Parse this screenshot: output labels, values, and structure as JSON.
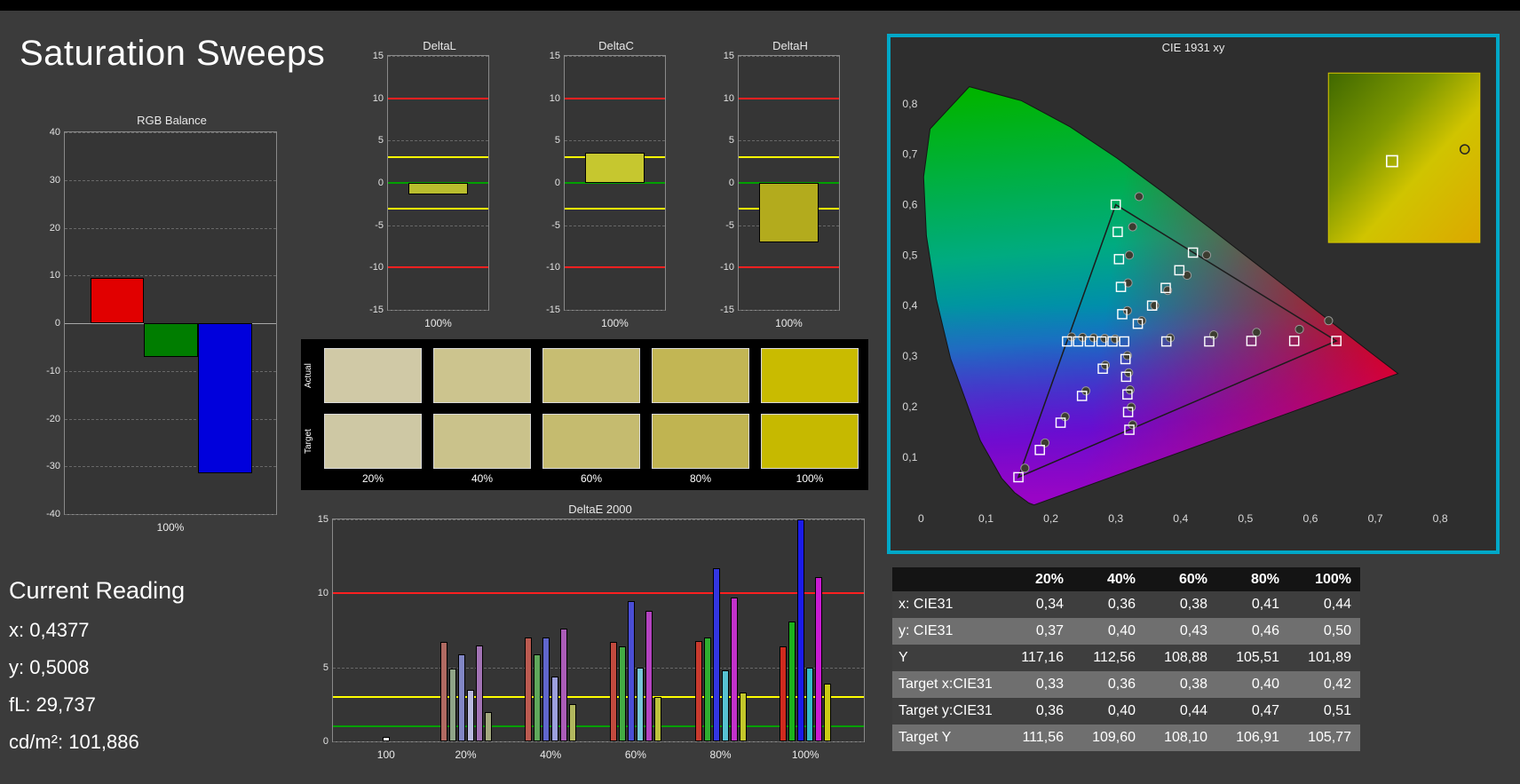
{
  "page": {
    "title": "Saturation Sweeps"
  },
  "current_reading": {
    "heading": "Current Reading",
    "x": "x: 0,4377",
    "y": "y: 0,5008",
    "fl": "fL: 29,737",
    "cdm2": "cd/m²: 101,886"
  },
  "colors": {
    "background": "#3b3b3b",
    "panel_highlight": "#00a8c8",
    "ref_red": "#ff2020",
    "ref_yellow": "#ffff00",
    "ref_green": "#00a000"
  },
  "swatches": {
    "row_labels": [
      "Actual",
      "Target"
    ],
    "col_labels": [
      "20%",
      "40%",
      "60%",
      "80%",
      "100%"
    ],
    "actual": [
      "#d0c9a6",
      "#ccc48e",
      "#c7bd72",
      "#c2b654",
      "#c9bb00"
    ],
    "target": [
      "#cec8a4",
      "#cac28b",
      "#c5bb6f",
      "#c0b451",
      "#c6b900"
    ]
  },
  "table": {
    "col_headers": [
      "20%",
      "40%",
      "60%",
      "80%",
      "100%"
    ],
    "rows": [
      {
        "label": "x: CIE31",
        "values": [
          "0,34",
          "0,36",
          "0,38",
          "0,41",
          "0,44"
        ]
      },
      {
        "label": "y: CIE31",
        "values": [
          "0,37",
          "0,40",
          "0,43",
          "0,46",
          "0,50"
        ]
      },
      {
        "label": "Y",
        "values": [
          "117,16",
          "112,56",
          "108,88",
          "105,51",
          "101,89"
        ]
      },
      {
        "label": "Target x:CIE31",
        "values": [
          "0,33",
          "0,36",
          "0,38",
          "0,40",
          "0,42"
        ]
      },
      {
        "label": "Target y:CIE31",
        "values": [
          "0,36",
          "0,40",
          "0,44",
          "0,47",
          "0,51"
        ]
      },
      {
        "label": "Target Y",
        "values": [
          "111,56",
          "109,60",
          "108,10",
          "106,91",
          "105,77"
        ]
      }
    ]
  },
  "chart_data": [
    {
      "id": "rgb_balance",
      "type": "bar",
      "title": "RGB Balance",
      "ylim": [
        -40,
        40
      ],
      "yticks": [
        40,
        30,
        20,
        10,
        0,
        -10,
        -20,
        -30,
        -40
      ],
      "xlabel": "100%",
      "series": [
        {
          "name": "Red",
          "value": 9.5,
          "color": "#e10000"
        },
        {
          "name": "Green",
          "value": -7,
          "color": "#007d00"
        },
        {
          "name": "Blue",
          "value": -31.5,
          "color": "#0000dc"
        }
      ]
    },
    {
      "id": "deltaL",
      "type": "bar",
      "title": "DeltaL",
      "ylim": [
        -15,
        15
      ],
      "yticks": [
        15,
        10,
        5,
        0,
        -5,
        -10,
        -15
      ],
      "ref_lines": [
        {
          "value": 10,
          "color": "#ff2020"
        },
        {
          "value": -10,
          "color": "#ff2020"
        },
        {
          "value": 3,
          "color": "#ffff00"
        },
        {
          "value": -3,
          "color": "#ffff00"
        },
        {
          "value": 0,
          "color": "#00a000"
        }
      ],
      "value": -1.4,
      "bar_color": "#b9bd2e",
      "xlabel": "100%"
    },
    {
      "id": "deltaC",
      "type": "bar",
      "title": "DeltaC",
      "ylim": [
        -15,
        15
      ],
      "yticks": [
        15,
        10,
        5,
        0,
        -5,
        -10,
        -15
      ],
      "ref_lines": [
        {
          "value": 10,
          "color": "#ff2020"
        },
        {
          "value": -10,
          "color": "#ff2020"
        },
        {
          "value": 3,
          "color": "#ffff00"
        },
        {
          "value": -3,
          "color": "#ffff00"
        },
        {
          "value": 0,
          "color": "#00a000"
        }
      ],
      "value": 3.6,
      "bar_color": "#c6c72f",
      "xlabel": "100%"
    },
    {
      "id": "deltaH",
      "type": "bar",
      "title": "DeltaH",
      "ylim": [
        -15,
        15
      ],
      "yticks": [
        15,
        10,
        5,
        0,
        -5,
        -10,
        -15
      ],
      "ref_lines": [
        {
          "value": 10,
          "color": "#ff2020"
        },
        {
          "value": -10,
          "color": "#ff2020"
        },
        {
          "value": 3,
          "color": "#ffff00"
        },
        {
          "value": -3,
          "color": "#ffff00"
        },
        {
          "value": 0,
          "color": "#00a000"
        }
      ],
      "value": -7,
      "bar_color": "#b3ab1d",
      "xlabel": "100%"
    },
    {
      "id": "deltaE",
      "type": "bar",
      "title": "DeltaE 2000",
      "ylim": [
        0,
        15
      ],
      "yticks": [
        15,
        10,
        5,
        0
      ],
      "ref_lines": [
        {
          "value": 10,
          "color": "#ff2020"
        },
        {
          "value": 3,
          "color": "#ffff00"
        },
        {
          "value": 1,
          "color": "#00a000"
        }
      ],
      "groups": [
        {
          "label": "100",
          "center": 10,
          "bars": [
            {
              "v": 0.3,
              "c": "#e8e8e8"
            }
          ]
        },
        {
          "label": "20%",
          "center": 25,
          "bars": [
            {
              "v": 6.7,
              "c": "#b06a62"
            },
            {
              "v": 4.9,
              "c": "#8fa488"
            },
            {
              "v": 5.9,
              "c": "#8186c4"
            },
            {
              "v": 3.5,
              "c": "#b9badf"
            },
            {
              "v": 6.5,
              "c": "#a273b4"
            },
            {
              "v": 2.0,
              "c": "#a3a87e"
            }
          ]
        },
        {
          "label": "40%",
          "center": 41,
          "bars": [
            {
              "v": 7.0,
              "c": "#bb5a50"
            },
            {
              "v": 5.9,
              "c": "#5fa75b"
            },
            {
              "v": 7.0,
              "c": "#6066cc"
            },
            {
              "v": 4.4,
              "c": "#9c9fdd"
            },
            {
              "v": 7.6,
              "c": "#ab5cb8"
            },
            {
              "v": 2.5,
              "c": "#b2b75e"
            }
          ]
        },
        {
          "label": "60%",
          "center": 57,
          "bars": [
            {
              "v": 6.7,
              "c": "#c24a3e"
            },
            {
              "v": 6.4,
              "c": "#43aa43"
            },
            {
              "v": 9.5,
              "c": "#4a4ed6"
            },
            {
              "v": 5.0,
              "c": "#78c6d8"
            },
            {
              "v": 8.8,
              "c": "#b343c0"
            },
            {
              "v": 3.0,
              "c": "#bcc23c"
            }
          ]
        },
        {
          "label": "80%",
          "center": 73,
          "bars": [
            {
              "v": 6.8,
              "c": "#c93a2e"
            },
            {
              "v": 7.0,
              "c": "#2fae2f"
            },
            {
              "v": 11.7,
              "c": "#3336e2"
            },
            {
              "v": 4.8,
              "c": "#57c2d2"
            },
            {
              "v": 9.7,
              "c": "#c231ca"
            },
            {
              "v": 3.3,
              "c": "#c3c72a"
            }
          ]
        },
        {
          "label": "100%",
          "center": 89,
          "bars": [
            {
              "v": 6.4,
              "c": "#d02a1e"
            },
            {
              "v": 8.1,
              "c": "#1bb21b"
            },
            {
              "v": 15.0,
              "c": "#1b1bea"
            },
            {
              "v": 5.0,
              "c": "#35bac8"
            },
            {
              "v": 11.1,
              "c": "#ca1bd2"
            },
            {
              "v": 3.9,
              "c": "#cacc14"
            }
          ]
        }
      ]
    },
    {
      "id": "cie",
      "type": "scatter",
      "title": "CIE 1931 xy",
      "xlim": [
        0,
        0.8
      ],
      "ylim": [
        0,
        0.85
      ],
      "xticks": [
        "0",
        "0,1",
        "0,2",
        "0,3",
        "0,4",
        "0,5",
        "0,6",
        "0,7",
        "0,8"
      ],
      "yticks": [
        "0,1",
        "0,2",
        "0,3",
        "0,4",
        "0,5",
        "0,6",
        "0,7",
        "0,8"
      ],
      "gamut_triangle": [
        [
          0.64,
          0.33
        ],
        [
          0.3,
          0.6
        ],
        [
          0.15,
          0.06
        ]
      ],
      "locus": [
        [
          0.1741,
          0.005
        ],
        [
          0.166,
          0.009
        ],
        [
          0.1566,
          0.0177
        ],
        [
          0.144,
          0.0297
        ],
        [
          0.1241,
          0.0578
        ],
        [
          0.0913,
          0.1327
        ],
        [
          0.0454,
          0.295
        ],
        [
          0.0235,
          0.4127
        ],
        [
          0.0082,
          0.5384
        ],
        [
          0.0039,
          0.6548
        ],
        [
          0.0139,
          0.7502
        ],
        [
          0.0743,
          0.8338
        ],
        [
          0.1547,
          0.8059
        ],
        [
          0.2296,
          0.7543
        ],
        [
          0.3016,
          0.6923
        ],
        [
          0.3731,
          0.6245
        ],
        [
          0.4441,
          0.5547
        ],
        [
          0.5125,
          0.4866
        ],
        [
          0.5752,
          0.4242
        ],
        [
          0.627,
          0.3725
        ],
        [
          0.6658,
          0.334
        ],
        [
          0.6915,
          0.3083
        ],
        [
          0.7079,
          0.292
        ],
        [
          0.735,
          0.2653
        ]
      ],
      "targets": [
        [
          0.378,
          0.329
        ],
        [
          0.444,
          0.329
        ],
        [
          0.509,
          0.33
        ],
        [
          0.575,
          0.33
        ],
        [
          0.64,
          0.33
        ],
        [
          0.31,
          0.383
        ],
        [
          0.308,
          0.437
        ],
        [
          0.305,
          0.492
        ],
        [
          0.303,
          0.546
        ],
        [
          0.3,
          0.6
        ],
        [
          0.28,
          0.275
        ],
        [
          0.248,
          0.221
        ],
        [
          0.215,
          0.168
        ],
        [
          0.183,
          0.114
        ],
        [
          0.15,
          0.06
        ],
        [
          0.295,
          0.329
        ],
        [
          0.278,
          0.329
        ],
        [
          0.26,
          0.329
        ],
        [
          0.242,
          0.329
        ],
        [
          0.225,
          0.329
        ],
        [
          0.315,
          0.294
        ],
        [
          0.316,
          0.259
        ],
        [
          0.318,
          0.224
        ],
        [
          0.319,
          0.189
        ],
        [
          0.321,
          0.154
        ],
        [
          0.334,
          0.364
        ],
        [
          0.356,
          0.4
        ],
        [
          0.377,
          0.435
        ],
        [
          0.398,
          0.47
        ],
        [
          0.419,
          0.505
        ],
        [
          0.313,
          0.329
        ]
      ],
      "measurements": [
        [
          0.384,
          0.336
        ],
        [
          0.451,
          0.342
        ],
        [
          0.517,
          0.347
        ],
        [
          0.583,
          0.353
        ],
        [
          0.628,
          0.37
        ],
        [
          0.318,
          0.39
        ],
        [
          0.319,
          0.445
        ],
        [
          0.321,
          0.5
        ],
        [
          0.326,
          0.556
        ],
        [
          0.336,
          0.616
        ],
        [
          0.284,
          0.282
        ],
        [
          0.254,
          0.231
        ],
        [
          0.222,
          0.18
        ],
        [
          0.191,
          0.128
        ],
        [
          0.16,
          0.078
        ],
        [
          0.299,
          0.334
        ],
        [
          0.283,
          0.335
        ],
        [
          0.266,
          0.336
        ],
        [
          0.249,
          0.337
        ],
        [
          0.232,
          0.338
        ],
        [
          0.318,
          0.301
        ],
        [
          0.32,
          0.267
        ],
        [
          0.322,
          0.233
        ],
        [
          0.324,
          0.199
        ],
        [
          0.326,
          0.164
        ],
        [
          0.34,
          0.37
        ],
        [
          0.36,
          0.4
        ],
        [
          0.38,
          0.43
        ],
        [
          0.41,
          0.46
        ],
        [
          0.44,
          0.5
        ]
      ],
      "inset": {
        "square": [
          0.42,
          0.52
        ],
        "circle": [
          0.9,
          0.45
        ]
      }
    }
  ]
}
